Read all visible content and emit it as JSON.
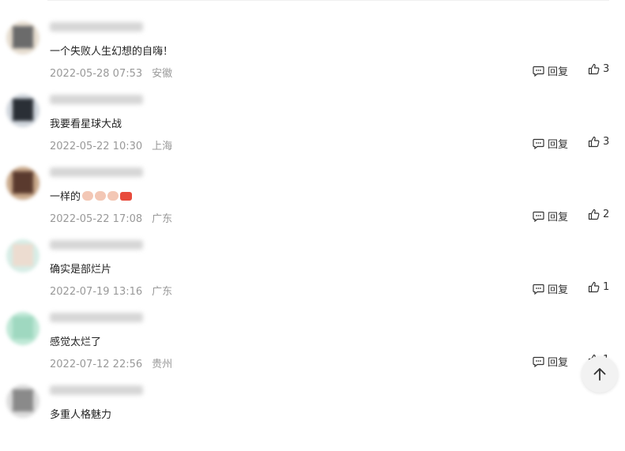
{
  "actions": {
    "reply_label": "回复"
  },
  "comments": [
    {
      "text": "一个失败人生幻想的自嗨！",
      "date": "2022-05-28 07:53",
      "location": "安徽",
      "likes": "3",
      "emojis": []
    },
    {
      "text": "我要看星球大战",
      "date": "2022-05-22 10:30",
      "location": "上海",
      "likes": "3",
      "emojis": []
    },
    {
      "text": "一样的",
      "date": "2022-05-22 17:08",
      "location": "广东",
      "likes": "2",
      "emojis": [
        "clap-emoji",
        "clap-emoji",
        "clap-emoji",
        "support-sticker"
      ]
    },
    {
      "text": "确实是部烂片",
      "date": "2022-07-19 13:16",
      "location": "广东",
      "likes": "1",
      "emojis": []
    },
    {
      "text": "感觉太烂了",
      "date": "2022-07-12 22:56",
      "location": "贵州",
      "likes": "1",
      "emojis": []
    },
    {
      "text": "多重人格魅力",
      "date": "",
      "location": "",
      "likes": "",
      "emojis": []
    }
  ],
  "colors": {
    "meta": "#999999",
    "text": "#222222",
    "divider": "#f0f0f0"
  },
  "icons": {
    "reply": "comment-bubble-icon",
    "like": "thumbs-up-icon",
    "scroll": "arrow-up-icon"
  }
}
